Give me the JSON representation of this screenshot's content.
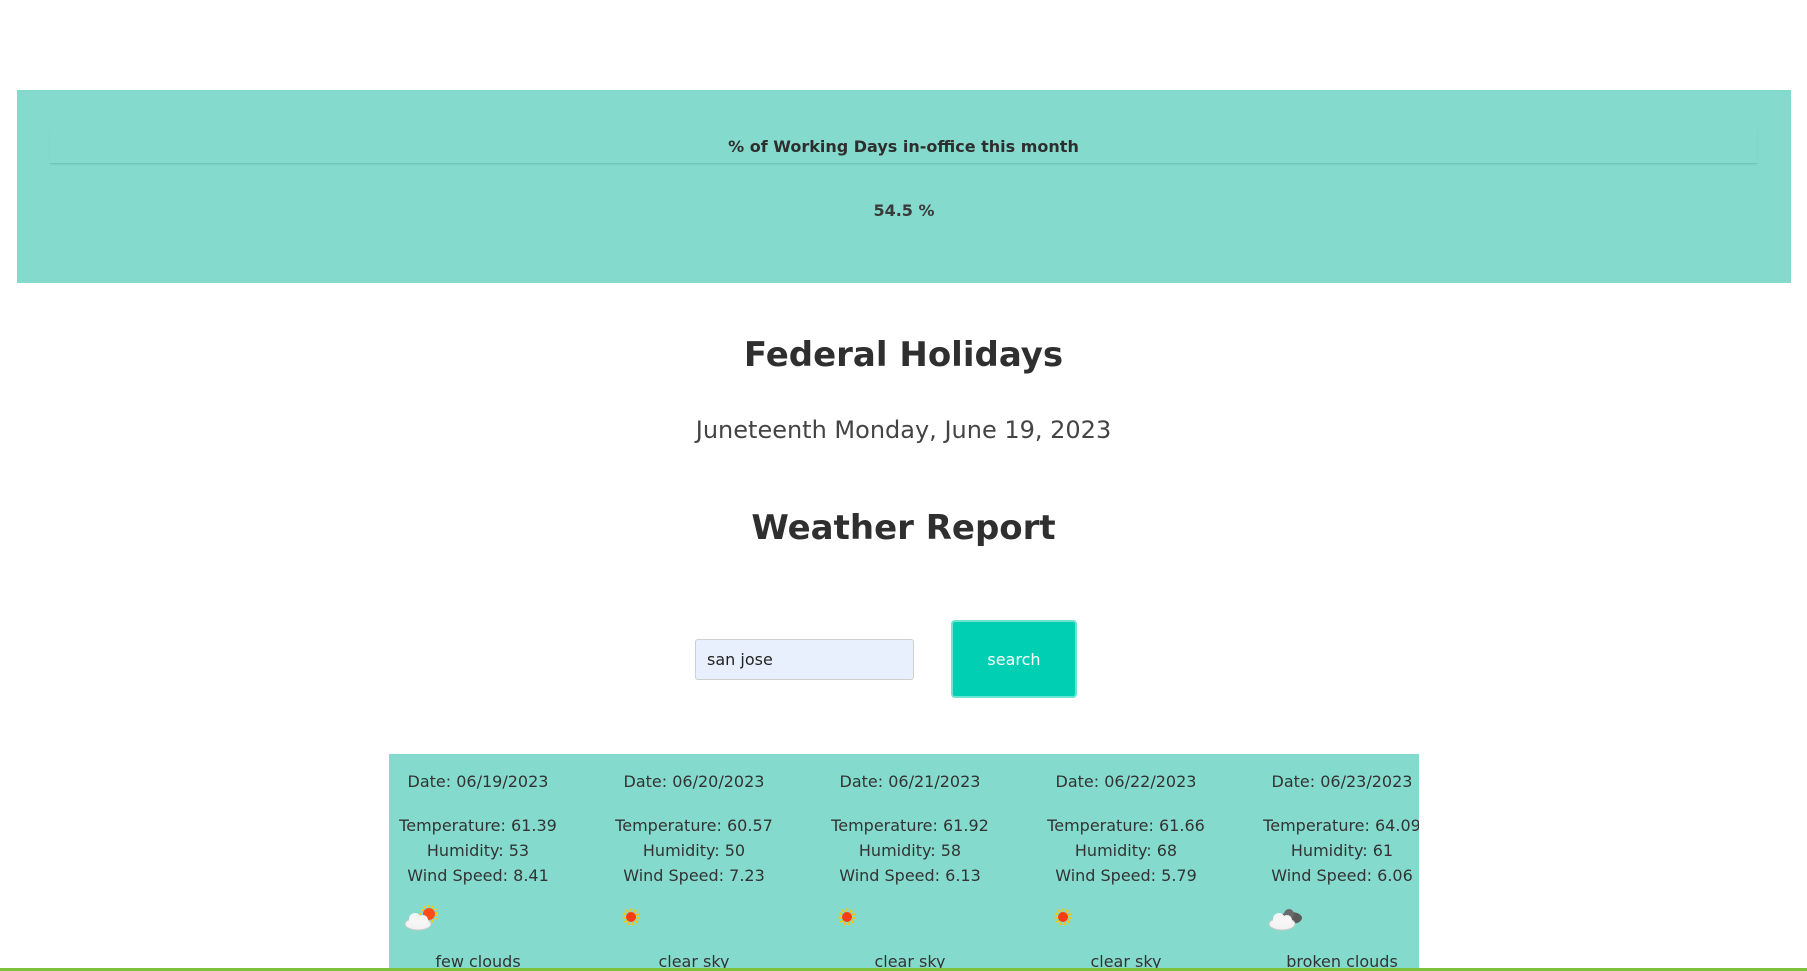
{
  "stats": {
    "title": "% of Working Days in-office this month",
    "value": "54.5 %"
  },
  "holidays": {
    "heading": "Federal Holidays",
    "next_holiday": "Juneteenth Monday, June 19, 2023"
  },
  "weather": {
    "heading": "Weather Report",
    "search_value": "san jose",
    "search_button_label": "search",
    "days": [
      {
        "date": "Date: 06/19/2023",
        "temperature": "Temperature: 61.39",
        "humidity": "Humidity: 53",
        "wind": "Wind Speed: 8.41",
        "icon": "few-clouds-icon",
        "description": "few clouds"
      },
      {
        "date": "Date: 06/20/2023",
        "temperature": "Temperature: 60.57",
        "humidity": "Humidity: 50",
        "wind": "Wind Speed: 7.23",
        "icon": "clear-sky-icon",
        "description": "clear sky"
      },
      {
        "date": "Date: 06/21/2023",
        "temperature": "Temperature: 61.92",
        "humidity": "Humidity: 58",
        "wind": "Wind Speed: 6.13",
        "icon": "clear-sky-icon",
        "description": "clear sky"
      },
      {
        "date": "Date: 06/22/2023",
        "temperature": "Temperature: 61.66",
        "humidity": "Humidity: 68",
        "wind": "Wind Speed: 5.79",
        "icon": "clear-sky-icon",
        "description": "clear sky"
      },
      {
        "date": "Date: 06/23/2023",
        "temperature": "Temperature: 64.09",
        "humidity": "Humidity: 61",
        "wind": "Wind Speed: 6.06",
        "icon": "broken-clouds-icon",
        "description": "broken clouds"
      }
    ]
  },
  "colors": {
    "band": "#84dbcd",
    "accent_button": "#00cfb4",
    "input_background": "#e8f0fe",
    "bottom_border": "#7ec13a"
  }
}
